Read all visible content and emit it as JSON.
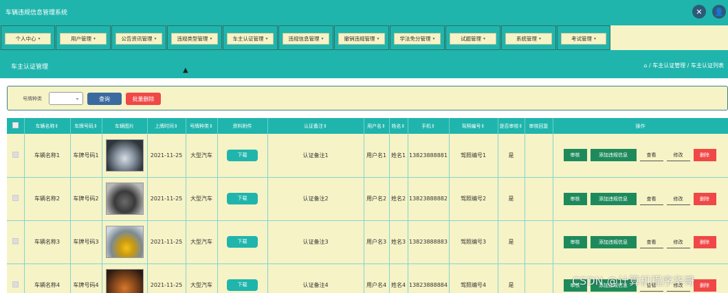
{
  "app": {
    "title": "车辆违规信息管理系统",
    "fullscreen_icon": "expand-icon",
    "user_icon": "user-icon"
  },
  "nav": {
    "items": [
      {
        "label": "个人中心"
      },
      {
        "label": "用户管理"
      },
      {
        "label": "公告资讯管理"
      },
      {
        "label": "违规类型管理"
      },
      {
        "label": "车主认证管理"
      },
      {
        "label": "违规信息管理"
      },
      {
        "label": "撤销违规管理"
      },
      {
        "label": "学法免分管理"
      },
      {
        "label": "试题管理"
      },
      {
        "label": "系统管理"
      },
      {
        "label": "考试管理"
      }
    ]
  },
  "page": {
    "title": "车主认证管理",
    "breadcrumb": "⌂ / 车主认证管理 / 车主认证列表"
  },
  "filter": {
    "label": "号牌种类",
    "select_value": "",
    "search_label": "查询",
    "batch_delete_label": "批量删除"
  },
  "table": {
    "headers": {
      "vehicle_name": "车辆名称⇕",
      "plate_no": "车牌号码⇕",
      "vehicle_image": "车辆图片",
      "upload_time": "上牌时间⇕",
      "plate_type": "号牌种类⇕",
      "attachment": "资料附件",
      "remark": "认证备注⇕",
      "username": "用户名⇕",
      "name": "姓名⇕",
      "phone": "手机⇕",
      "license_no": "驾照编号⇕",
      "is_approved": "是否审核⇕",
      "review_reply": "审核回复",
      "actions": "操作"
    },
    "download_label": "下载",
    "action_labels": {
      "review": "审核",
      "add_violation": "添加违规信息",
      "view": "查看",
      "edit": "修改",
      "delete": "删除"
    },
    "rows": [
      {
        "vehicle_name": "车辆名称1",
        "plate_no": "车牌号码1",
        "image_theme": "grey-sedan",
        "upload_time": "2021-11-25",
        "plate_type": "大型汽车",
        "remark": "认证备注1",
        "username": "用户名1",
        "name": "姓名1",
        "phone": "13823888881",
        "license_no": "驾照编号1",
        "is_approved": "是",
        "review_reply": ""
      },
      {
        "vehicle_name": "车辆名称2",
        "plate_no": "车牌号码2",
        "image_theme": "dark-muscle",
        "upload_time": "2021-11-25",
        "plate_type": "大型汽车",
        "remark": "认证备注2",
        "username": "用户名2",
        "name": "姓名2",
        "phone": "13823888882",
        "license_no": "驾照编号2",
        "is_approved": "是",
        "review_reply": ""
      },
      {
        "vehicle_name": "车辆名称3",
        "plate_no": "车牌号码3",
        "image_theme": "yellow-sport",
        "upload_time": "2021-11-25",
        "plate_type": "大型汽车",
        "remark": "认证备注3",
        "username": "用户名3",
        "name": "姓名3",
        "phone": "13823888883",
        "license_no": "驾照编号3",
        "is_approved": "是",
        "review_reply": ""
      },
      {
        "vehicle_name": "车辆名称4",
        "plate_no": "车牌号码4",
        "image_theme": "orange-sport",
        "upload_time": "2021-11-25",
        "plate_type": "大型汽车",
        "remark": "认证备注4",
        "username": "用户名4",
        "name": "姓名4",
        "phone": "13823888884",
        "license_no": "驾照编号4",
        "is_approved": "是",
        "review_reply": ""
      }
    ]
  },
  "watermark": "CSDN @计算机程序华哥",
  "colors": {
    "primary": "#1fb5ac",
    "panel": "#f6f3c6",
    "search_button": "#3a6aa0",
    "danger": "#f04747",
    "action_green": "#1e8a5c"
  }
}
